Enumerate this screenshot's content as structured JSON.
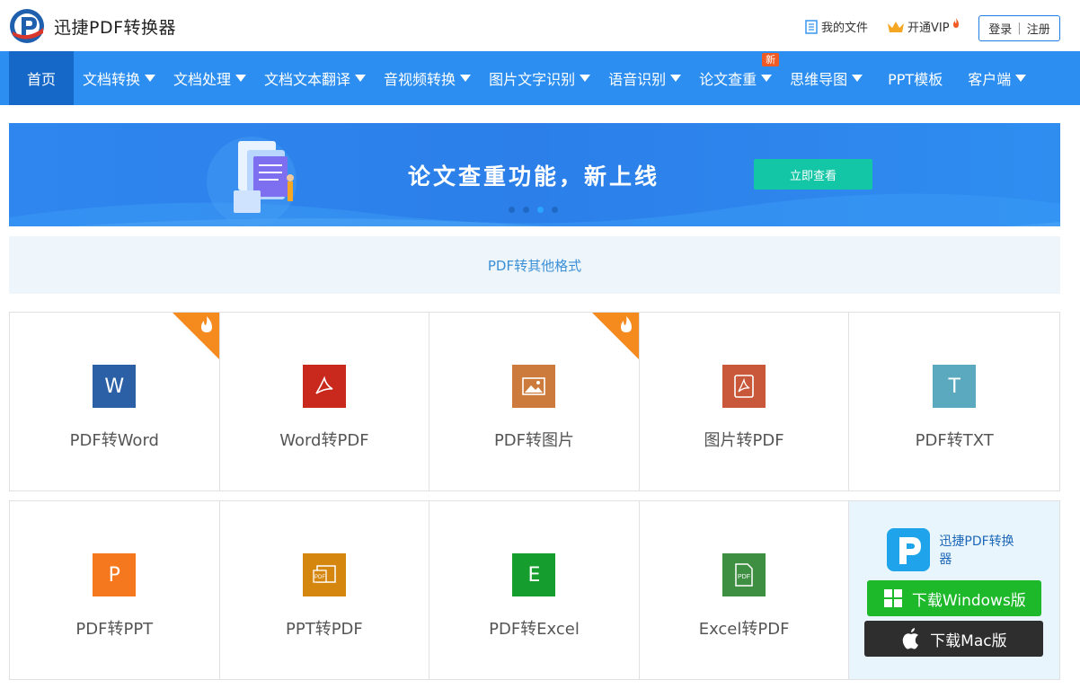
{
  "header": {
    "brand": "迅捷PDF转换器",
    "my_files": "我的文件",
    "vip": "开通VIP",
    "login": "登录",
    "separator": "|",
    "register": "注册"
  },
  "nav": {
    "items": [
      {
        "label": "首页",
        "dropdown": false
      },
      {
        "label": "文档转换",
        "dropdown": true
      },
      {
        "label": "文档处理",
        "dropdown": true
      },
      {
        "label": "文档文本翻译",
        "dropdown": true
      },
      {
        "label": "音视频转换",
        "dropdown": true
      },
      {
        "label": "图片文字识别",
        "dropdown": true
      },
      {
        "label": "语音识别",
        "dropdown": true
      },
      {
        "label": "论文查重",
        "dropdown": true,
        "badge": "新"
      },
      {
        "label": "思维导图",
        "dropdown": true
      },
      {
        "label": "PPT模板",
        "dropdown": false
      },
      {
        "label": "客户端",
        "dropdown": true
      }
    ]
  },
  "banner": {
    "title": "论文查重功能，新上线",
    "button": "立即查看",
    "slide_count": 4,
    "active_slide": 3
  },
  "section": {
    "title": "PDF转其他格式"
  },
  "tools_row1": [
    {
      "label": "PDF转Word",
      "icon": "word-icon",
      "glyph": "W",
      "color": "#2b5fa6",
      "hot": true
    },
    {
      "label": "Word转PDF",
      "icon": "acrobat-icon",
      "glyph": "",
      "color": "#c9281c",
      "hot": false
    },
    {
      "label": "PDF转图片",
      "icon": "image-icon",
      "glyph": "",
      "color": "#cd7a3d",
      "hot": true
    },
    {
      "label": "图片转PDF",
      "icon": "pdf-acrobat-icon",
      "glyph": "",
      "color": "#c9583a",
      "hot": false
    },
    {
      "label": "PDF转TXT",
      "icon": "text-icon",
      "glyph": "T",
      "color": "#5aa9bf",
      "hot": false
    }
  ],
  "tools_row2": [
    {
      "label": "PDF转PPT",
      "icon": "ppt-icon",
      "glyph": "P",
      "color": "#f5781f"
    },
    {
      "label": "PPT转PDF",
      "icon": "ppt-pdf-icon",
      "glyph": "",
      "color": "#d4860f"
    },
    {
      "label": "PDF转Excel",
      "icon": "excel-icon",
      "glyph": "E",
      "color": "#159e2e"
    },
    {
      "label": "Excel转PDF",
      "icon": "excel-pdf-icon",
      "glyph": "",
      "color": "#3f8f43"
    }
  ],
  "promo": {
    "app_name": "迅捷PDF转换器",
    "download_windows": "下载Windows版",
    "download_mac": "下载Mac版"
  },
  "colors": {
    "nav_bg": "#2b8ef0",
    "nav_active": "#1568c8",
    "accent_teal": "#12c6a6",
    "download_green": "#1db92b"
  }
}
